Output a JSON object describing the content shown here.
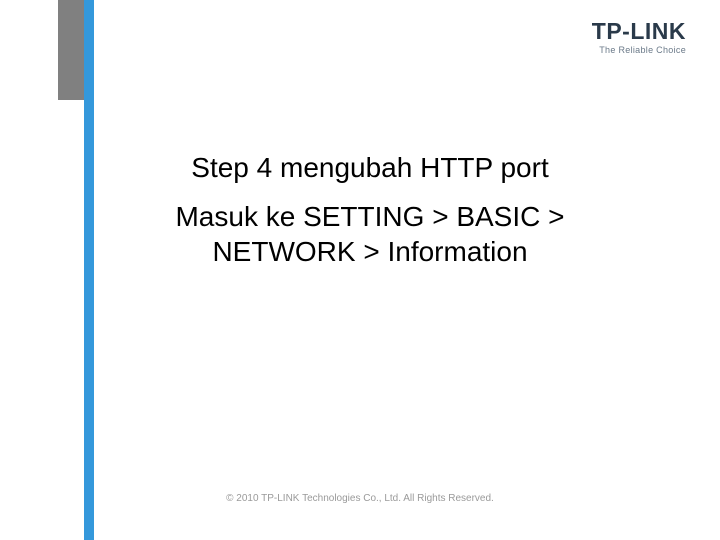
{
  "logo": {
    "brand": "TP-LINK",
    "tagline": "The Reliable Choice"
  },
  "content": {
    "title": "Step 4 mengubah HTTP port",
    "body": "Masuk ke SETTING > BASIC > NETWORK > Information"
  },
  "footer": {
    "copyright": "© 2010 TP-LINK Technologies Co., Ltd. All Rights Reserved."
  }
}
